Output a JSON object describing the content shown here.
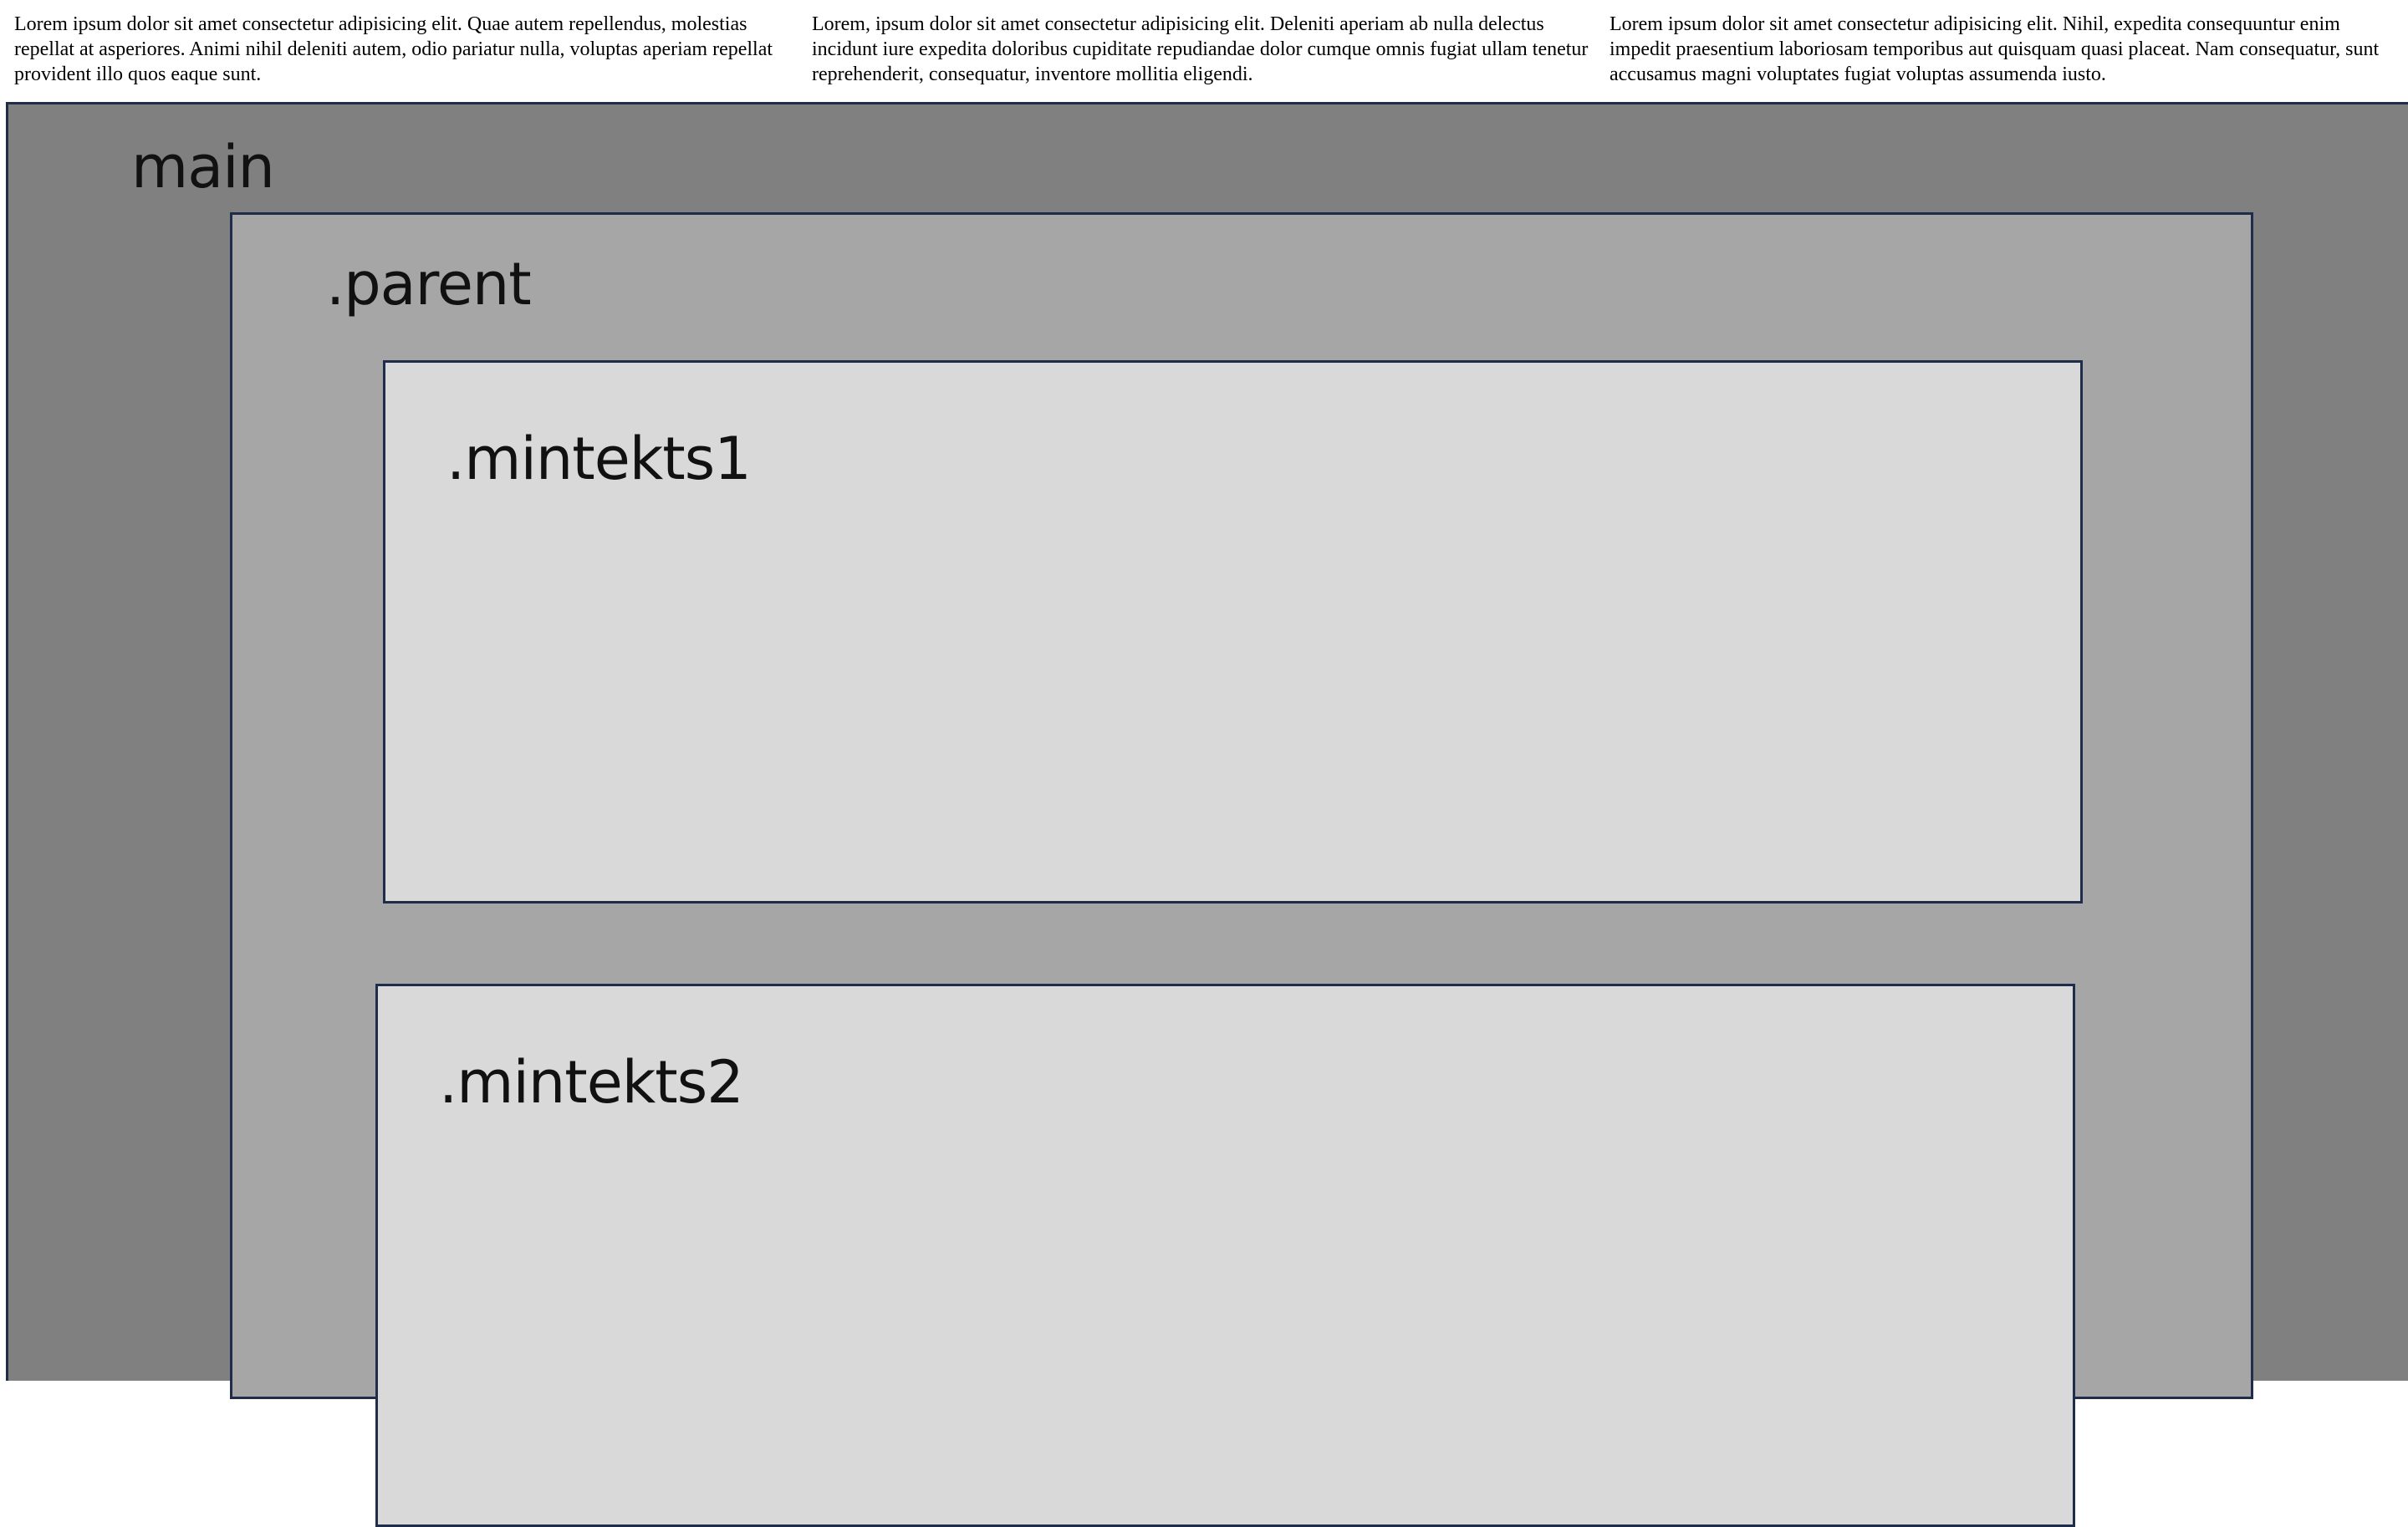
{
  "columns": [
    {
      "text": "Lorem ipsum dolor sit amet consectetur adipisicing elit. Quae autem repellendus, molestias repellat at asperiores. Animi nihil deleniti autem, odio pariatur nulla, voluptas aperiam repellat provident illo quos eaque sunt."
    },
    {
      "text": "Lorem, ipsum dolor sit amet consectetur adipisicing elit. Deleniti aperiam ab nulla delectus incidunt iure expedita doloribus cupiditate repudiandae dolor cumque omnis fugiat ullam tenetur reprehenderit, consequatur, inventore mollitia eligendi."
    },
    {
      "text": "Lorem ipsum dolor sit amet consectetur adipisicing elit. Nihil, expedita consequuntur enim impedit praesentium laboriosam temporibus aut quisquam quasi placeat. Nam consequatur, sunt accusamus magni voluptates fugiat voluptas assumenda iusto."
    }
  ],
  "diagram": {
    "main_label": "main",
    "parent_label": ".parent",
    "children": [
      {
        "label": ".mintekts1"
      },
      {
        "label": ".mintekts2"
      }
    ]
  },
  "colors": {
    "main_bg": "#808080",
    "parent_bg": "#a6a6a6",
    "child_bg": "#d9d9d9",
    "border": "#1f2d4a"
  }
}
